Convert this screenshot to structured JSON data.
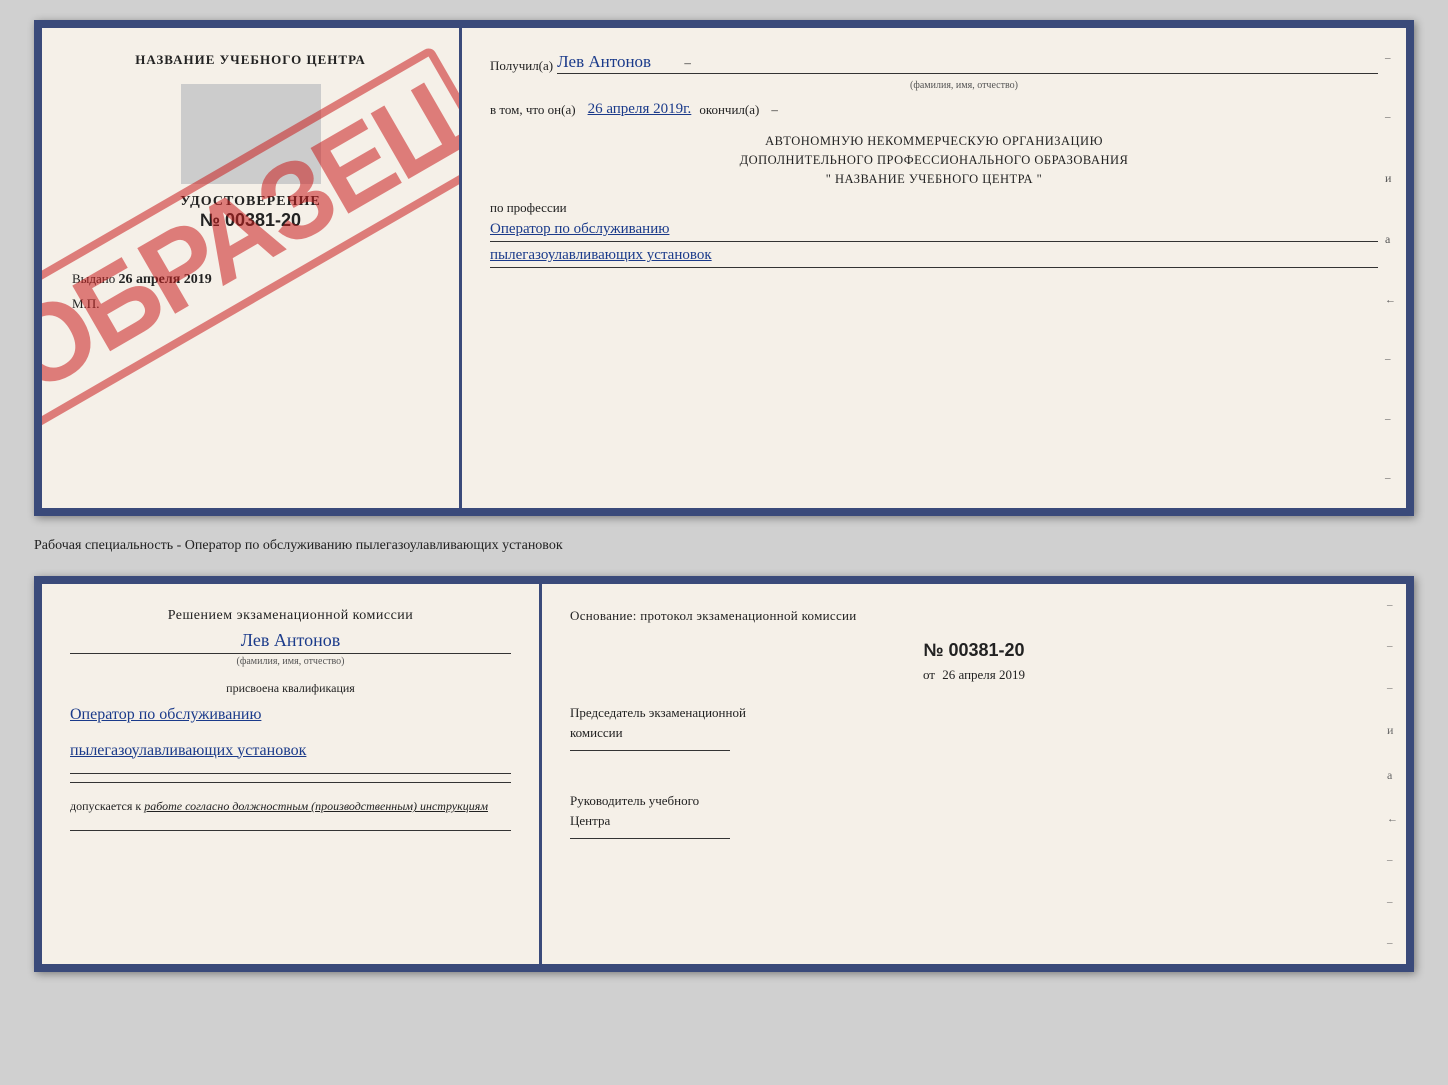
{
  "top_doc": {
    "left": {
      "center_title": "НАЗВАНИЕ УЧЕБНОГО ЦЕНТРА",
      "udostoverenie_label": "УДОСТОВЕРЕНИЕ",
      "number": "№ 00381-20",
      "vydano_label": "Выдано",
      "vydano_date": "26 апреля 2019",
      "mp_label": "М.П.",
      "stamp_text": "ОБРАЗЕЦ"
    },
    "right": {
      "poluchil_label": "Получил(а)",
      "poluchil_name": "Лев Антонов",
      "fio_sub": "(фамилия, имя, отчество)",
      "vtom_label": "в том, что он(а)",
      "vtom_date": "26 апреля 2019г.",
      "okonchil_label": "окончил(а)",
      "block_line1": "АВТОНОМНУЮ НЕКОММЕРЧЕСКУЮ ОРГАНИЗАЦИЮ",
      "block_line2": "ДОПОЛНИТЕЛЬНОГО ПРОФЕССИОНАЛЬНОГО ОБРАЗОВАНИЯ",
      "block_line3": "\"   НАЗВАНИЕ УЧЕБНОГО ЦЕНТРА   \"",
      "po_professii_label": "по профессии",
      "profession_line1": "Оператор по обслуживанию",
      "profession_line2": "пылегазоулавливающих установок"
    }
  },
  "separator": {
    "text": "Рабочая специальность - Оператор по обслуживанию пылегазоулавливающих установок"
  },
  "bottom_doc": {
    "left": {
      "resheniyem_text": "Решением экзаменационной комиссии",
      "name": "Лев Антонов",
      "fio_sub": "(фамилия, имя, отчество)",
      "prisvoena_text": "присвоена квалификация",
      "qualification_line1": "Оператор по обслуживанию",
      "qualification_line2": "пылегазоулавливающих установок",
      "dopuskaetsya_prefix": "допускается к",
      "dopuskaetsya_suffix": "работе согласно должностным (производственным) инструкциям"
    },
    "right": {
      "osnovaniye_text": "Основание: протокол экзаменационной комиссии",
      "protocol_num": "№ 00381-20",
      "ot_label": "от",
      "ot_date": "26 апреля 2019",
      "predsedatel_line1": "Председатель экзаменационной",
      "predsedatel_line2": "комиссии",
      "rukovoditel_line1": "Руководитель учебного",
      "rukovoditel_line2": "Центра"
    }
  }
}
